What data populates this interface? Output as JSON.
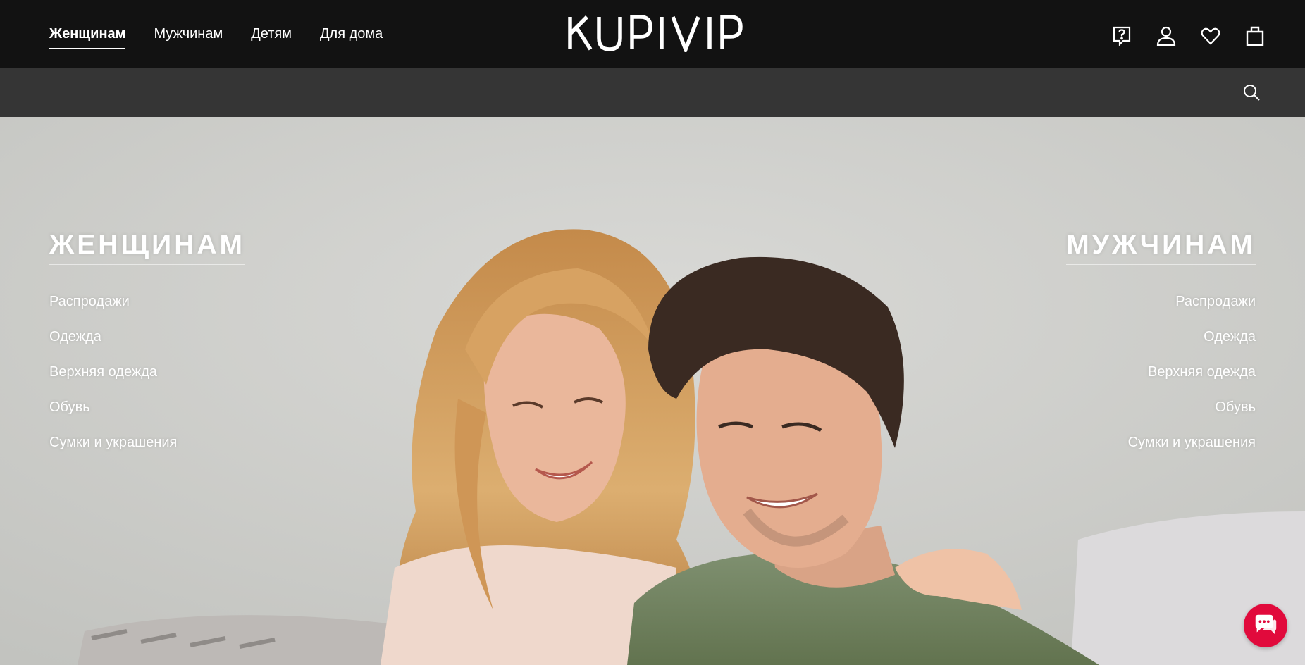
{
  "header": {
    "nav": [
      {
        "label": "Женщинам",
        "active": true
      },
      {
        "label": "Мужчинам",
        "active": false
      },
      {
        "label": "Детям",
        "active": false
      },
      {
        "label": "Для дома",
        "active": false
      }
    ],
    "logo_text": "KUPIVIP",
    "icons": [
      "help-icon",
      "user-icon",
      "heart-icon",
      "bag-icon"
    ]
  },
  "search": {
    "value": "",
    "placeholder": "",
    "icon": "search-icon"
  },
  "hero": {
    "women": {
      "title": "ЖЕНЩИНАМ",
      "links": [
        "Распродажи",
        "Одежда",
        "Верхняя одежда",
        "Обувь",
        "Сумки и украшения"
      ]
    },
    "men": {
      "title": "МУЖЧИНАМ",
      "links": [
        "Распродажи",
        "Одежда",
        "Верхняя одежда",
        "Обувь",
        "Сумки и украшения"
      ]
    }
  },
  "chat": {
    "icon": "chat-icon",
    "color": "#e10a3c"
  },
  "colors": {
    "header_bg": "#121212",
    "search_bg": "#353535",
    "text": "#ffffff"
  }
}
